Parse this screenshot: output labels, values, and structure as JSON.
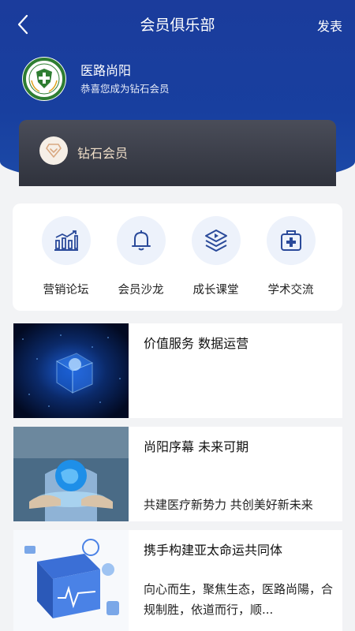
{
  "header": {
    "title": "会员俱乐部",
    "action_label": "发表"
  },
  "profile": {
    "name": "医路尚阳",
    "subtitle": "恭喜您成为钻石会员"
  },
  "vip": {
    "label": "钻石会员"
  },
  "menu": [
    {
      "label": "营销论坛",
      "icon": "chart-icon"
    },
    {
      "label": "会员沙龙",
      "icon": "bell-icon"
    },
    {
      "label": "成长课堂",
      "icon": "video-stack-icon"
    },
    {
      "label": "学术交流",
      "icon": "medical-kit-icon"
    }
  ],
  "articles": [
    {
      "title": "价值服务 数据运营",
      "desc": ""
    },
    {
      "title": "尚阳序幕 未来可期",
      "desc": "共建医疗新势力 共创美好新未来"
    },
    {
      "title": "携手构建亚太命运共同体",
      "desc": "向心而生，聚焦生态，医路尚陽，合规制胜，依道而行，顺..."
    }
  ],
  "colors": {
    "header_blue": "#1b3c9c",
    "vip_dark": "#3a3d48",
    "vip_gold": "#f0dec8",
    "icon_blue": "#2a4a9a"
  }
}
